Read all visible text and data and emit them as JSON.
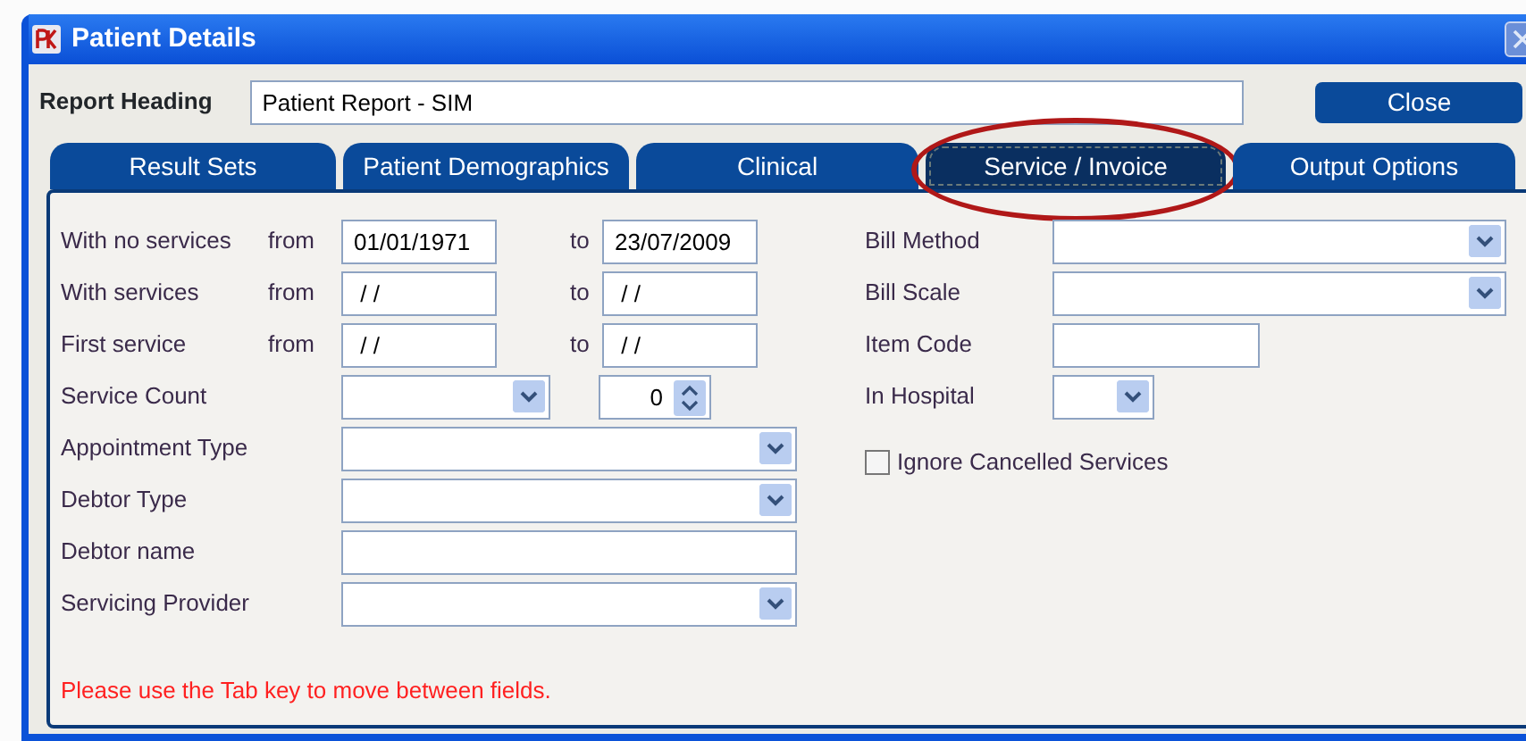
{
  "window": {
    "title": "Patient Details"
  },
  "report_heading": {
    "label": "Report Heading",
    "value": "Patient Report - SIM"
  },
  "close_button": "Close",
  "tabs": [
    {
      "label": "Result Sets",
      "selected": false,
      "circled": false
    },
    {
      "label": "Patient Demographics",
      "selected": false,
      "circled": false
    },
    {
      "label": "Clinical",
      "selected": false,
      "circled": false
    },
    {
      "label": "Service / Invoice",
      "selected": true,
      "circled": true
    },
    {
      "label": "Output Options",
      "selected": false,
      "circled": false
    }
  ],
  "left_fields": [
    {
      "kind": "date_range",
      "label": "With no services",
      "from_label": "from",
      "from_value": "01/01/1971",
      "to_label": "to",
      "to_value": "23/07/2009"
    },
    {
      "kind": "date_range",
      "label": "With services",
      "from_label": "from",
      "from_value": " / /",
      "to_label": "to",
      "to_value": " / /"
    },
    {
      "kind": "date_range",
      "label": "First service",
      "from_label": "from",
      "from_value": " / /",
      "to_label": "to",
      "to_value": " / /"
    },
    {
      "kind": "combo_spin",
      "label": "Service Count",
      "spin_value": "0"
    },
    {
      "kind": "combo",
      "label": "Appointment Type"
    },
    {
      "kind": "combo",
      "label": "Debtor Type"
    },
    {
      "kind": "text",
      "label": "Debtor name"
    },
    {
      "kind": "combo",
      "label": "Servicing Provider"
    }
  ],
  "right_fields": [
    {
      "kind": "combo",
      "label": "Bill Method"
    },
    {
      "kind": "combo",
      "label": "Bill Scale"
    },
    {
      "kind": "text",
      "label": "Item Code"
    },
    {
      "kind": "small_combo",
      "label": "In Hospital"
    },
    {
      "kind": "checkbox",
      "label": "Ignore Cancelled Services",
      "checked": false
    }
  ],
  "hint": "Please use the Tab key to move between fields."
}
